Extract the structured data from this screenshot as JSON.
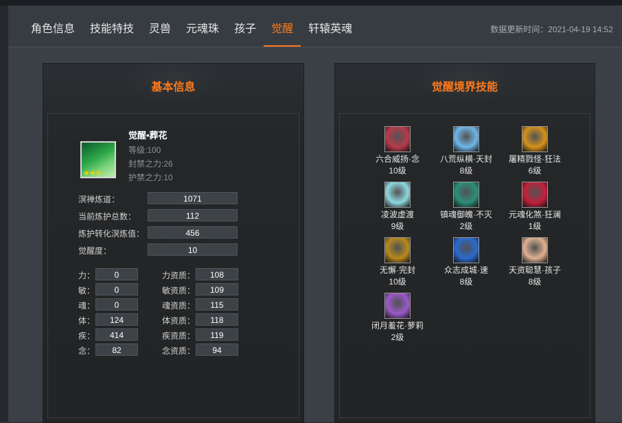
{
  "tabs": [
    "角色信息",
    "技能特技",
    "灵兽",
    "元魂珠",
    "孩子",
    "觉醒",
    "轩辕英魂"
  ],
  "active_tab": "觉醒",
  "update_label": "数据更新时间：",
  "update_time": "2021-04-19 14:52",
  "basic": {
    "title": "基本信息",
    "name": "觉醒•葬花",
    "level": "等级:100",
    "seal_power": "封禁之力:26",
    "guard_power": "护禁之力:10",
    "stats": [
      {
        "label": "溟禅炼道：",
        "value": "1071"
      },
      {
        "label": "当前炼护总数：",
        "value": "112"
      },
      {
        "label": "炼护转化溟炼值：",
        "value": "456"
      },
      {
        "label": "觉醒度：",
        "value": "10"
      }
    ],
    "attrs": [
      {
        "label": "力：",
        "value": "0",
        "q_label": "力资质：",
        "q_value": "108"
      },
      {
        "label": "敏：",
        "value": "0",
        "q_label": "敏资质：",
        "q_value": "109"
      },
      {
        "label": "魂：",
        "value": "0",
        "q_label": "魂资质：",
        "q_value": "115"
      },
      {
        "label": "体：",
        "value": "124",
        "q_label": "体资质：",
        "q_value": "118"
      },
      {
        "label": "疾：",
        "value": "414",
        "q_label": "疾资质：",
        "q_value": "119"
      },
      {
        "label": "念：",
        "value": "82",
        "q_label": "念资质：",
        "q_value": "94"
      }
    ]
  },
  "skills_panel": {
    "title": "觉醒境界技能",
    "skills": [
      {
        "name": "六合威扬·念",
        "level": "10级",
        "color": "#b83a4a"
      },
      {
        "name": "八荒纵横·天封",
        "level": "8级",
        "color": "#6fb6e8"
      },
      {
        "name": "屠精戮怪·狂法",
        "level": "6级",
        "color": "#d4921c"
      },
      {
        "name": "凌波虚渡",
        "level": "9级",
        "color": "#8fd8e0"
      },
      {
        "name": "镇魂御魄·不灭",
        "level": "2级",
        "color": "#2c8f7a"
      },
      {
        "name": "元魂化煞·狂澜",
        "level": "1级",
        "color": "#c2203a"
      },
      {
        "name": "无懈·完封",
        "level": "10级",
        "color": "#b88a1c"
      },
      {
        "name": "众志成城·速",
        "level": "8级",
        "color": "#2a6ad0"
      },
      {
        "name": "天资聪慧·孩子",
        "level": "8级",
        "color": "#e0b090"
      },
      {
        "name": "闭月羞花·萝莉",
        "level": "2级",
        "color": "#9a5ac8"
      }
    ]
  },
  "colors": {
    "accent": "#ff7a1a",
    "background": "#2e3338",
    "panel": "#232628"
  }
}
